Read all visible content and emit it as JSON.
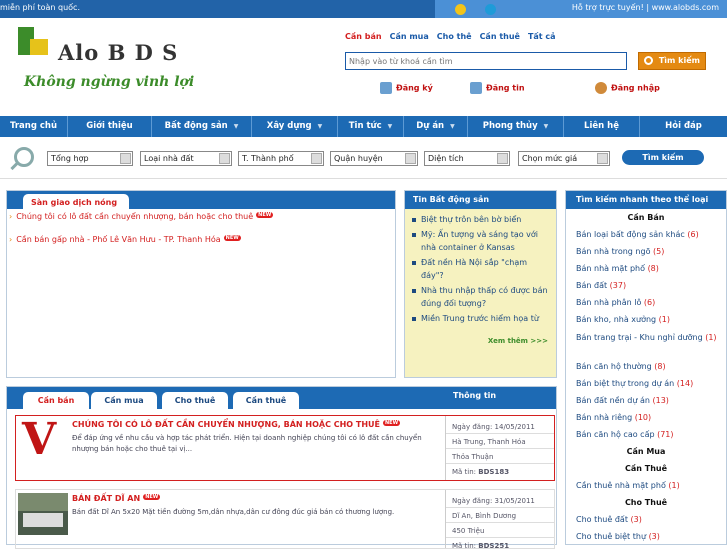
{
  "topbar": {
    "marquee": "miễn phí toàn quốc.",
    "support": "Hỗ trợ trực tuyến! | www.alobds.com"
  },
  "header": {
    "logo_text": "Alo B D S",
    "slogan": "Không ngừng vinh lợi",
    "search_tabs": [
      "Cần bán",
      "Cần mua",
      "Cho thê",
      "Cần thuê",
      "Tất cả"
    ],
    "search_placeholder": "Nhập vào từ khoá cần tìm",
    "search_button": "Tìm kiếm",
    "register": "Đăng ký",
    "post": "Đăng tin",
    "login": "Đăng nhập"
  },
  "nav": {
    "items": [
      "Trang chủ",
      "Giới thiệu",
      "Bất động sản",
      "Xây dựng",
      "Tin tức",
      "Dự án",
      "Phong thủy",
      "Liên hệ",
      "Hỏi đáp"
    ]
  },
  "filter": {
    "selects": [
      "Tổng hợp",
      "Loại nhà đất",
      "T. Thành phố",
      "Quận huyện",
      "Diện tích",
      "Chọn mức giá"
    ],
    "button": "Tìm kiếm"
  },
  "hot": {
    "tab": "Sàn giao dịch nóng",
    "items": [
      "Chúng tôi có lô đất cần chuyển nhượng, bán hoặc cho thuê",
      "Cần bán gấp nhà - Phố Lê Văn Hưu - TP. Thanh Hóa"
    ],
    "new_badge": "NEW"
  },
  "news": {
    "title": "Tin Bất động sản",
    "items": [
      "Biệt thự trôn bên bờ biển",
      "Mỹ: Ấn tượng và sáng tạo với nhà container ở Kansas",
      "Đất nền Hà Nội sắp \"chạm đáy\"?",
      "Nhà thu nhập thấp có được bán đúng đối tượng?",
      "Miền Trung trước hiểm họa từ"
    ],
    "more": "Xem thêm >>>"
  },
  "quick": {
    "title": "Tìm kiếm nhanh theo thể loại",
    "groups": [
      {
        "name": "Cần Bán",
        "items": [
          {
            "label": "Bán loại bất động sản khác",
            "count": "(6)"
          },
          {
            "label": "Bán nhà trong ngõ",
            "count": "(5)"
          },
          {
            "label": "Bán nhà mặt phố",
            "count": "(8)"
          },
          {
            "label": "Bán đất",
            "count": "(37)"
          },
          {
            "label": "Bán nhà phân lô",
            "count": "(6)"
          },
          {
            "label": "Bán kho, nhà xưởng",
            "count": "(1)"
          },
          {
            "label": "Bán trang trại - Khu nghỉ dưỡng",
            "count": "(1)"
          },
          {
            "label": "Bán căn hộ thường",
            "count": "(8)"
          },
          {
            "label": "Bán biệt thự trong dự án",
            "count": "(14)"
          },
          {
            "label": "Bán đất nền dự án",
            "count": "(13)"
          },
          {
            "label": "Bán nhà riêng",
            "count": "(10)"
          },
          {
            "label": "Bán căn hộ cao cấp",
            "count": "(71)"
          }
        ]
      },
      {
        "name": "Cần Mua",
        "items": []
      },
      {
        "name": "Cần Thuê",
        "items": [
          {
            "label": "Cần thuê nhà mặt phố",
            "count": "(1)"
          }
        ]
      },
      {
        "name": "Cho Thuê",
        "items": [
          {
            "label": "Cho thuê đất",
            "count": "(3)"
          },
          {
            "label": "Cho thuê biệt thự",
            "count": "(3)"
          }
        ]
      }
    ]
  },
  "listings": {
    "tabs": [
      "Cần bán",
      "Cần mua",
      "Cho thuê",
      "Cần thuê"
    ],
    "info_header": "Thông tin",
    "items": [
      {
        "title": "CHÚNG TÔI CÓ LÔ ĐẤT CẦN CHUYỂN NHƯỢNG, BÁN HOẶC CHO THUÊ",
        "desc": "Để đáp ứng về nhu cầu và hợp tác phát triển. Hiện tại doanh nghiệp chúng tôi có lô đất cần chuyển nhượng bán hoặc cho thuê tại vị...",
        "date": "Ngày đăng: 14/05/2011",
        "location": "Hà Trung, Thanh Hóa",
        "price": "Thỏa Thuận",
        "code_label": "Mã tin:",
        "code": "BDS183"
      },
      {
        "title": "BÁN ĐẤT DĨ AN",
        "desc": "Bán đất Dĩ An 5x20 Mặt tiền đường 5m,dân nhựa,dân cư đông đúc giá bán có thương lượng.",
        "date": "Ngày đăng: 31/05/2011",
        "location": "Dĩ An, Bình Dương",
        "price": "450 Triệu",
        "code_label": "Mã tin:",
        "code": "BDS251"
      }
    ]
  },
  "colors": {
    "primary": "#1d6ab4",
    "accent": "#d32020",
    "orange": "#e48a12",
    "green": "#3c8c2a"
  }
}
